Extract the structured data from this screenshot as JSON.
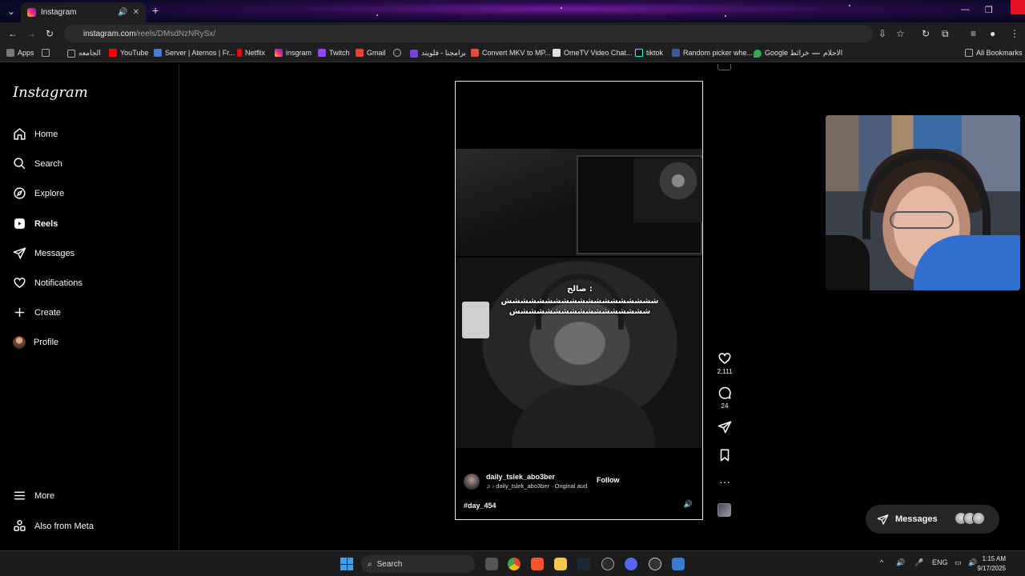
{
  "browser": {
    "tab_title": "Instagram",
    "url_host": "instagram.com",
    "url_path": "/reels/DMsdNzNRySx/",
    "bookmarks": [
      "Apps",
      "الجامعه",
      "YouTube",
      "Server | Aternos | Fr...",
      "Netflix",
      "insgram",
      "Twitch",
      "Gmail",
      "",
      "برامجنا - فلويند",
      "Convert MKV to MP...",
      "OmeTV Video Chat...",
      "tiktok",
      "Random picker whe...",
      "Google خرائط",
      "الاحلام"
    ],
    "all_bookmarks": "All Bookmarks"
  },
  "sidebar": {
    "logo": "Instagram",
    "items": [
      {
        "label": "Home",
        "icon": "home-icon"
      },
      {
        "label": "Search",
        "icon": "search-icon"
      },
      {
        "label": "Explore",
        "icon": "explore-icon"
      },
      {
        "label": "Reels",
        "icon": "reels-icon"
      },
      {
        "label": "Messages",
        "icon": "messages-icon"
      },
      {
        "label": "Notifications",
        "icon": "heart-icon"
      },
      {
        "label": "Create",
        "icon": "plus-icon"
      },
      {
        "label": "Profile",
        "icon": "avatar"
      }
    ],
    "more": "More",
    "also_from_meta": "Also from Meta"
  },
  "reel": {
    "caption_line1": "صالح :",
    "caption_line2": "ششششششششششششششششششش",
    "caption_line3": "ششششششششششششششششش",
    "author": "daily_tslek_abo3ber",
    "audio": "daily_tslek_abo3ber · Original aud",
    "follow": "Follow",
    "hashtag": "#day_454",
    "likes": "2,111",
    "comments": "24"
  },
  "messages_pill": {
    "label": "Messages"
  },
  "taskbar": {
    "search": "Search",
    "lang": "ENG",
    "time": "1:15 AM",
    "date": "9/17/2025"
  },
  "colors": {
    "accent": "#3aa0f3",
    "close_red": "#e81123",
    "pill": "#262626"
  }
}
